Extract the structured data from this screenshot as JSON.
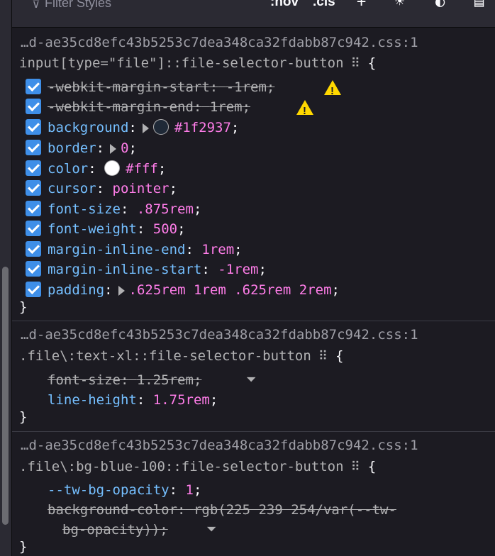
{
  "toolbar": {
    "filter_placeholder": "Filter Styles",
    "hov_label": ":hov",
    "cls_label": ".cls"
  },
  "rules": [
    {
      "source": "…d-ae35cd8efc43b5253c7dea348ca32fdabb87c942.css:1",
      "selector": "input[type=\"file\"]::file-selector-button",
      "declarations": [
        {
          "name": "-webkit-margin-start",
          "value": "-1rem",
          "overridden": true,
          "warning": true
        },
        {
          "name": "-webkit-margin-end",
          "value": "1rem",
          "overridden": true,
          "warning": true
        },
        {
          "name": "background",
          "value": "#1f2937",
          "swatch": "#1f2937",
          "expandable": true
        },
        {
          "name": "border",
          "value": "0",
          "expandable": true
        },
        {
          "name": "color",
          "value": "#fff",
          "swatch": "#ffffff"
        },
        {
          "name": "cursor",
          "value": "pointer"
        },
        {
          "name": "font-size",
          "value": ".875rem"
        },
        {
          "name": "font-weight",
          "value": "500"
        },
        {
          "name": "margin-inline-end",
          "value": "1rem"
        },
        {
          "name": "margin-inline-start",
          "value": "-1rem"
        },
        {
          "name": "padding",
          "value": ".625rem 1rem .625rem 2rem",
          "expandable": true
        }
      ]
    },
    {
      "source": "…d-ae35cd8efc43b5253c7dea348ca32fdabb87c942.css:1",
      "selector": ".file\\:text-xl::file-selector-button",
      "declarations": [
        {
          "name": "font-size",
          "value": "1.25rem",
          "overridden": true
        },
        {
          "name": "line-height",
          "value": "1.75rem"
        }
      ]
    },
    {
      "source": "…d-ae35cd8efc43b5253c7dea348ca32fdabb87c942.css:1",
      "selector": ".file\\:bg-blue-100::file-selector-button",
      "declarations": [
        {
          "name": "--tw-bg-opacity",
          "value": "1"
        },
        {
          "name": "background-color",
          "value_line1": "rgb(225 239 254/var(--tw-",
          "value_line2": "bg-opacity))",
          "overridden": true
        }
      ]
    }
  ],
  "closing_brace": "}",
  "open_brace": "{",
  "colon": ":",
  "semicolon": ";"
}
